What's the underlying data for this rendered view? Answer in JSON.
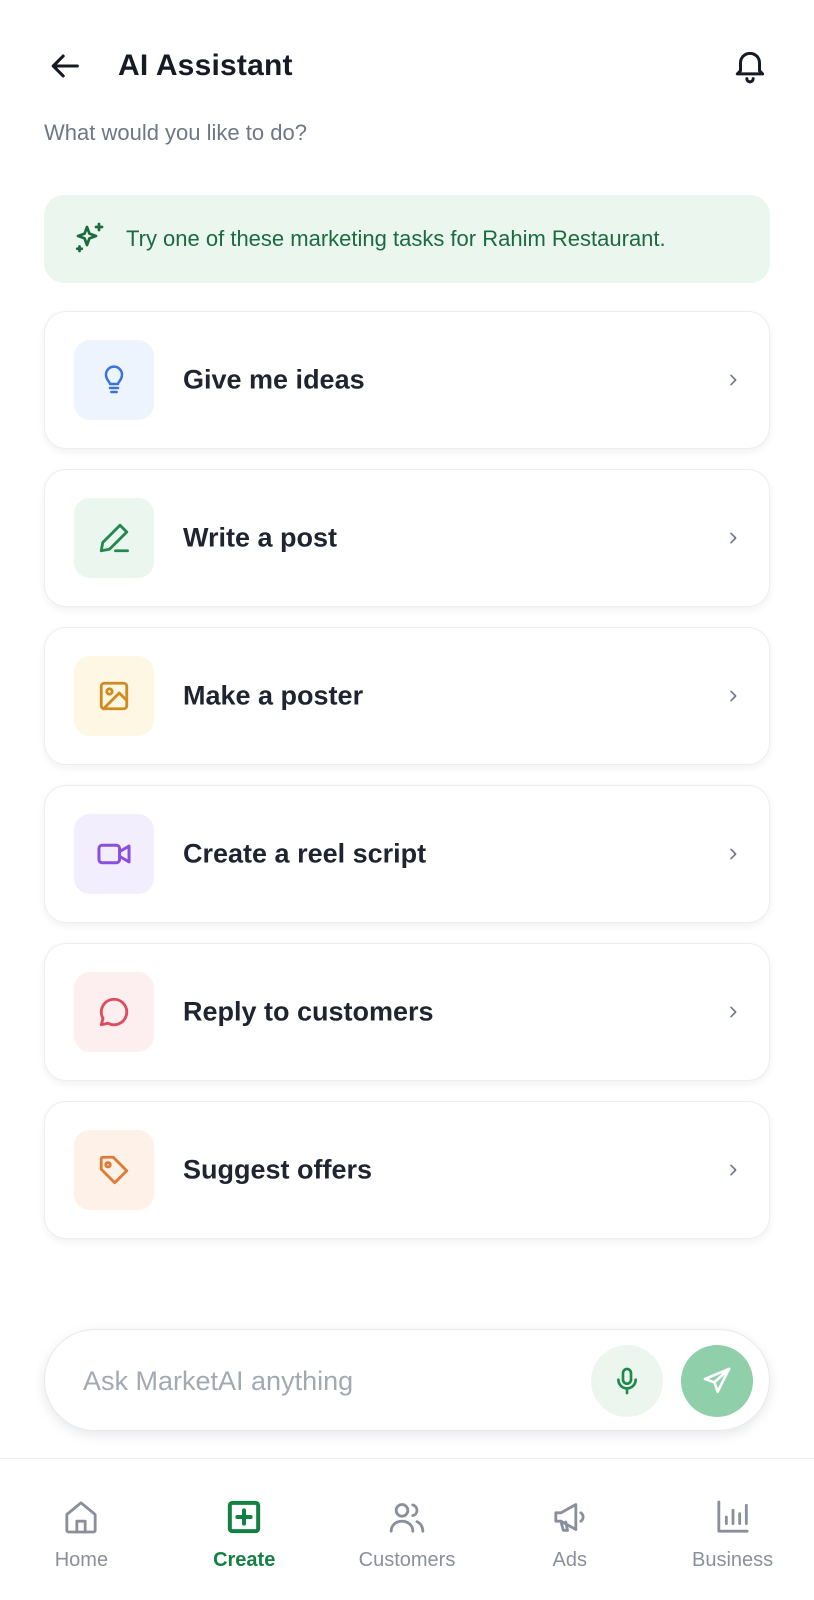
{
  "header": {
    "title": "AI Assistant",
    "subtitle": "What would you like to do?",
    "back_icon": "arrow-left-icon",
    "notifications_icon": "bell-icon"
  },
  "banner": {
    "icon": "sparkles-icon",
    "text": "Try one of these marketing tasks for Rahim Restaurant.",
    "background": "#eaf6ee",
    "text_color": "#1b6b3f"
  },
  "tasks": [
    {
      "label": "Give me ideas",
      "icon": "lightbulb-icon",
      "icon_color": "#3a74d9",
      "icon_bg": "#eef4fe"
    },
    {
      "label": "Write a post",
      "icon": "pen-icon",
      "icon_color": "#1f8a4c",
      "icon_bg": "#eaf6ee"
    },
    {
      "label": "Make a poster",
      "icon": "image-icon",
      "icon_color": "#d08a1f",
      "icon_bg": "#fdf7e4"
    },
    {
      "label": "Create a reel script",
      "icon": "video-icon",
      "icon_color": "#8a4fe0",
      "icon_bg": "#f3eefd"
    },
    {
      "label": "Reply to customers",
      "icon": "chat-bubble-icon",
      "icon_color": "#de4b5b",
      "icon_bg": "#fdeeef"
    },
    {
      "label": "Suggest offers",
      "icon": "tag-icon",
      "icon_color": "#e07a35",
      "icon_bg": "#fdf1e8"
    }
  ],
  "ask": {
    "placeholder": "Ask MarketAI anything",
    "value": "",
    "mic_icon": "microphone-icon",
    "send_icon": "send-icon"
  },
  "nav": {
    "items": [
      {
        "label": "Home",
        "icon": "home-icon",
        "active": false
      },
      {
        "label": "Create",
        "icon": "plus-square-icon",
        "active": true
      },
      {
        "label": "Customers",
        "icon": "users-icon",
        "active": false
      },
      {
        "label": "Ads",
        "icon": "megaphone-icon",
        "active": false
      },
      {
        "label": "Business",
        "icon": "bar-chart-icon",
        "active": false
      }
    ]
  },
  "colors": {
    "accent": "#148043",
    "text_primary": "#1f2430",
    "text_muted": "#6f7685",
    "nav_inactive": "#8a909b"
  }
}
